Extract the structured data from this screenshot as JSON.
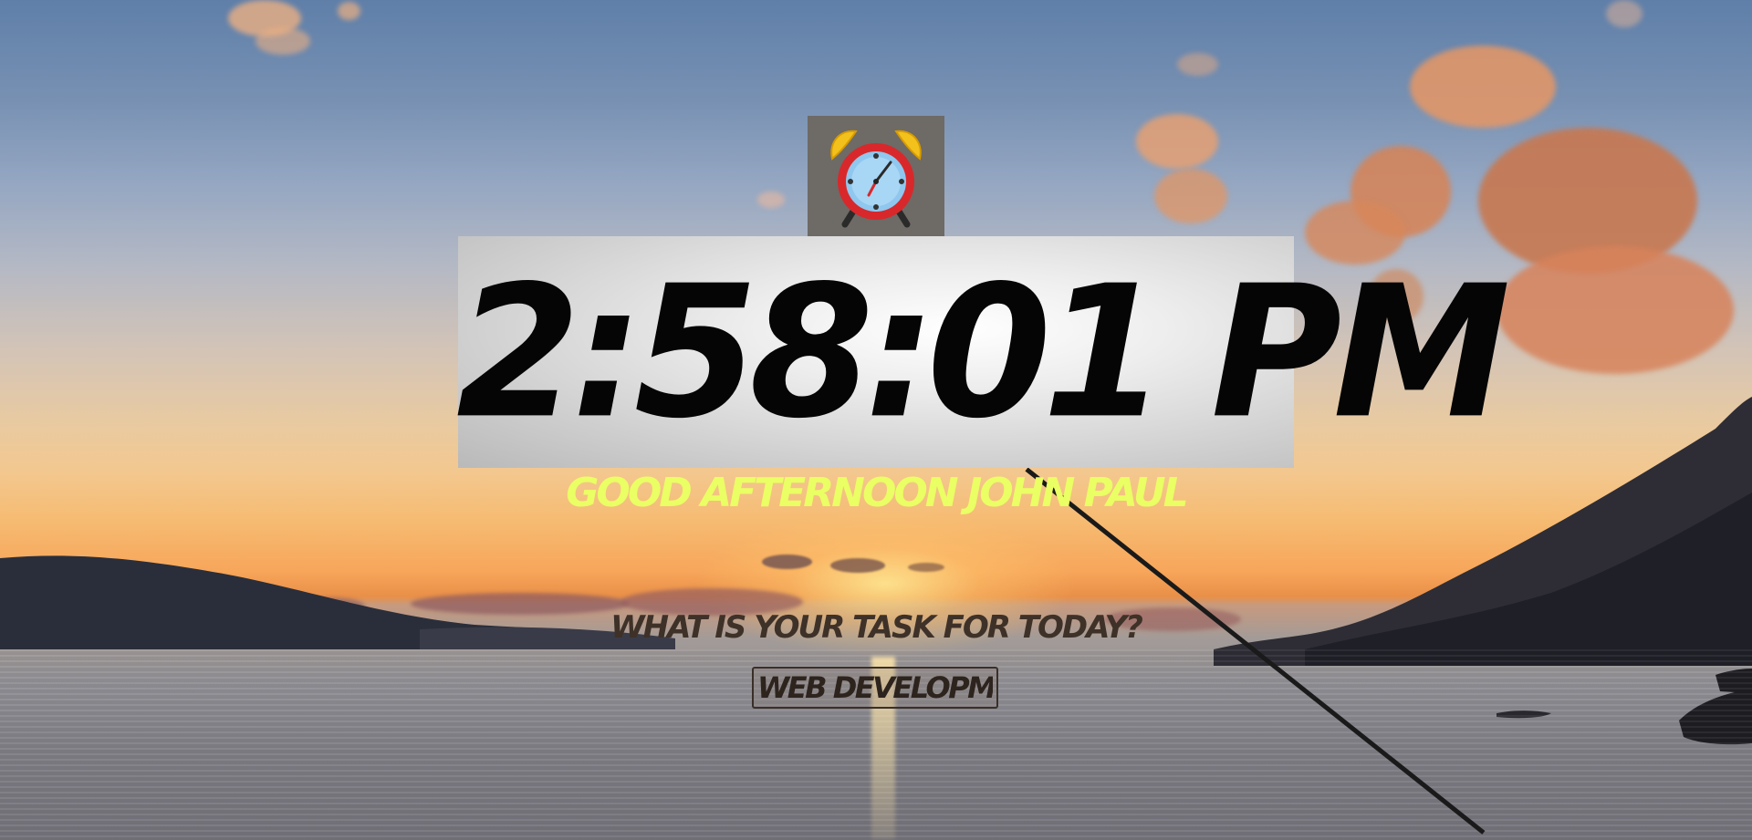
{
  "clock": {
    "time": "2:58:01 PM"
  },
  "greeting": {
    "text": "GOOD AFTERNOON JOHN PAUL"
  },
  "focus": {
    "question": "WHAT IS YOUR TASK FOR TODAY?",
    "task_value": "WEB DEVELOPMENT"
  },
  "icons": {
    "alarm": "alarm-clock-icon"
  },
  "colors": {
    "greeting": "#eaff63",
    "clock_text": "#050505",
    "question": "#3e3128"
  }
}
